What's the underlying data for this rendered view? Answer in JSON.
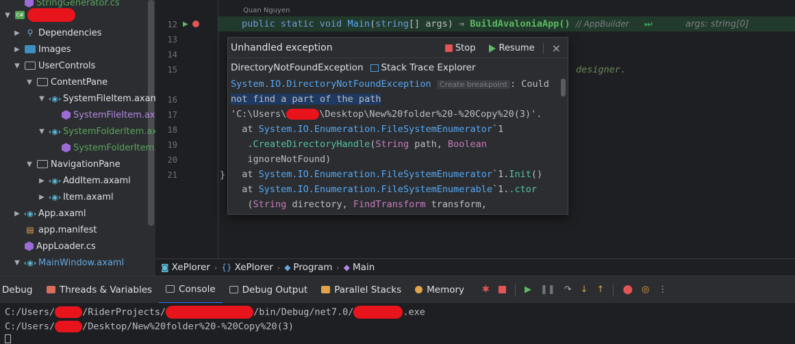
{
  "tree": {
    "items": [
      {
        "label": "StringGenerator.cs",
        "kind": "cs",
        "color": "green"
      },
      {
        "label": "",
        "kind": "project",
        "redacted": true
      },
      {
        "label": "Dependencies",
        "kind": "dep"
      },
      {
        "label": "Images",
        "kind": "img"
      },
      {
        "label": "UserControls",
        "kind": "folder"
      },
      {
        "label": "ContentPane",
        "kind": "folder"
      },
      {
        "label": "SystemFileItem.axaml",
        "kind": "axaml"
      },
      {
        "label": "SystemFileItem.axa",
        "kind": "cs",
        "color": "purple"
      },
      {
        "label": "SystemFolderItem.ax",
        "kind": "axaml",
        "color": "green"
      },
      {
        "label": "SystemFolderItem.",
        "kind": "cs",
        "color": "green"
      },
      {
        "label": "NavigationPane",
        "kind": "folder"
      },
      {
        "label": "AddItem.axaml",
        "kind": "axaml"
      },
      {
        "label": "Item.axaml",
        "kind": "axaml"
      },
      {
        "label": "App.axaml",
        "kind": "axaml"
      },
      {
        "label": "app.manifest",
        "kind": "manifest"
      },
      {
        "label": "AppLoader.cs",
        "kind": "cs"
      },
      {
        "label": "MainWindow.axaml",
        "kind": "axaml",
        "color": "blue"
      }
    ]
  },
  "editor": {
    "author": "Quan Nguyen",
    "line_numbers": [
      "12",
      "13",
      "14",
      "15",
      "16",
      "17",
      "18",
      "19",
      "20",
      "21"
    ],
    "line12": {
      "p1": "public static void ",
      "fn": "Main",
      "p2": "(",
      "ty": "string",
      "p3": "[] args) ⇒ ",
      "call": "BuildAvaloniaApp()",
      "hint": "// AppBuilder",
      "args_hint": "args: string[0]"
    },
    "line15_tail": "designer.",
    "line21": "}"
  },
  "popup": {
    "title": "Unhandled exception",
    "stop_label": "Stop",
    "resume_label": "Resume",
    "close_glyph": "×",
    "exception_type": "DirectoryNotFoundException",
    "stack_trace_label": "Stack Trace Explorer",
    "trace": {
      "l1_type": "System.IO.DirectoryNotFoundException",
      "l1_bp": "Create breakpoint",
      "l1_msg": ": Could",
      "l2": "not find a part of the path",
      "l3a": "'C:\\Users\\",
      "l3b": "\\Desktop\\New%20folder%20-%20Copy%20(3)'.",
      "l4a": "  at ",
      "l4b": "System.IO.Enumeration.FileSystemEnumerator",
      "l4c": "`1",
      "l5a": "   .",
      "l5b": "CreateDirectoryHandle",
      "l5c": "(",
      "l5d": "String",
      "l5e": " path, ",
      "l5f": "Boolean",
      "l6": "   ignoreNotFound)",
      "l7a": "  at ",
      "l7b": "System.IO.Enumeration.FileSystemEnumerator",
      "l7c": "`1.",
      "l7d": "Init",
      "l7e": "()",
      "l8a": "  at ",
      "l8b": "System.IO.Enumeration.FileSystemEnumerable",
      "l8c": "`1.",
      "l8d": ".ctor",
      "l9a": "   (",
      "l9b": "String",
      "l9c": " directory, ",
      "l9d": "FindTransform",
      "l9e": " transform,"
    }
  },
  "breadcrumbs": [
    "XePlorer",
    "XePlorer",
    "Program",
    "Main"
  ],
  "debug": {
    "title": "Debug",
    "tabs": [
      "Threads & Variables",
      "Console",
      "Debug Output",
      "Parallel Stacks",
      "Memory"
    ],
    "active_tab": "Console"
  },
  "console": {
    "line1a": "C:/Users/",
    "line1b": "/RiderProjects/",
    "line1c": "/bin/Debug/net7.0/",
    "line1d": ".exe",
    "line2a": "C:/Users/",
    "line2b": "/Desktop/New%20folder%20-%20Copy%20(3)"
  },
  "colors": {
    "accent": "#3574f0",
    "stop": "#e45454",
    "resume": "#5fb865",
    "redaction": "#e8141c"
  }
}
